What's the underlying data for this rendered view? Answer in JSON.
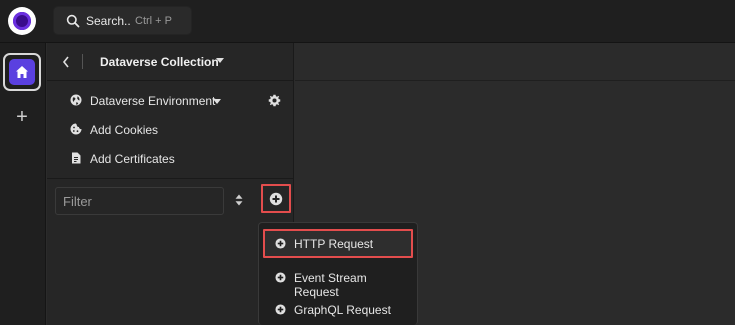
{
  "search": {
    "label": "Search..",
    "shortcut": "Ctrl + P"
  },
  "rail": {
    "home_icon": "home-icon",
    "add_label": "+"
  },
  "panel": {
    "collection_title": "Dataverse Collection",
    "environment_label": "Dataverse Environment",
    "cookies_label": "Add Cookies",
    "certificates_label": "Add Certificates",
    "filter_placeholder": "Filter"
  },
  "menu": {
    "items": [
      {
        "label": "HTTP Request",
        "icon": "plus-circle-icon"
      },
      {
        "label": "Event Stream Request",
        "icon": "plus-circle-icon"
      },
      {
        "label": "GraphQL Request",
        "icon": "plus-circle-icon"
      }
    ]
  },
  "colors": {
    "accent": "#5a40e0",
    "highlight": "#e34d4d",
    "background": "#2b2b2b",
    "topbar": "#1f1f1f"
  }
}
